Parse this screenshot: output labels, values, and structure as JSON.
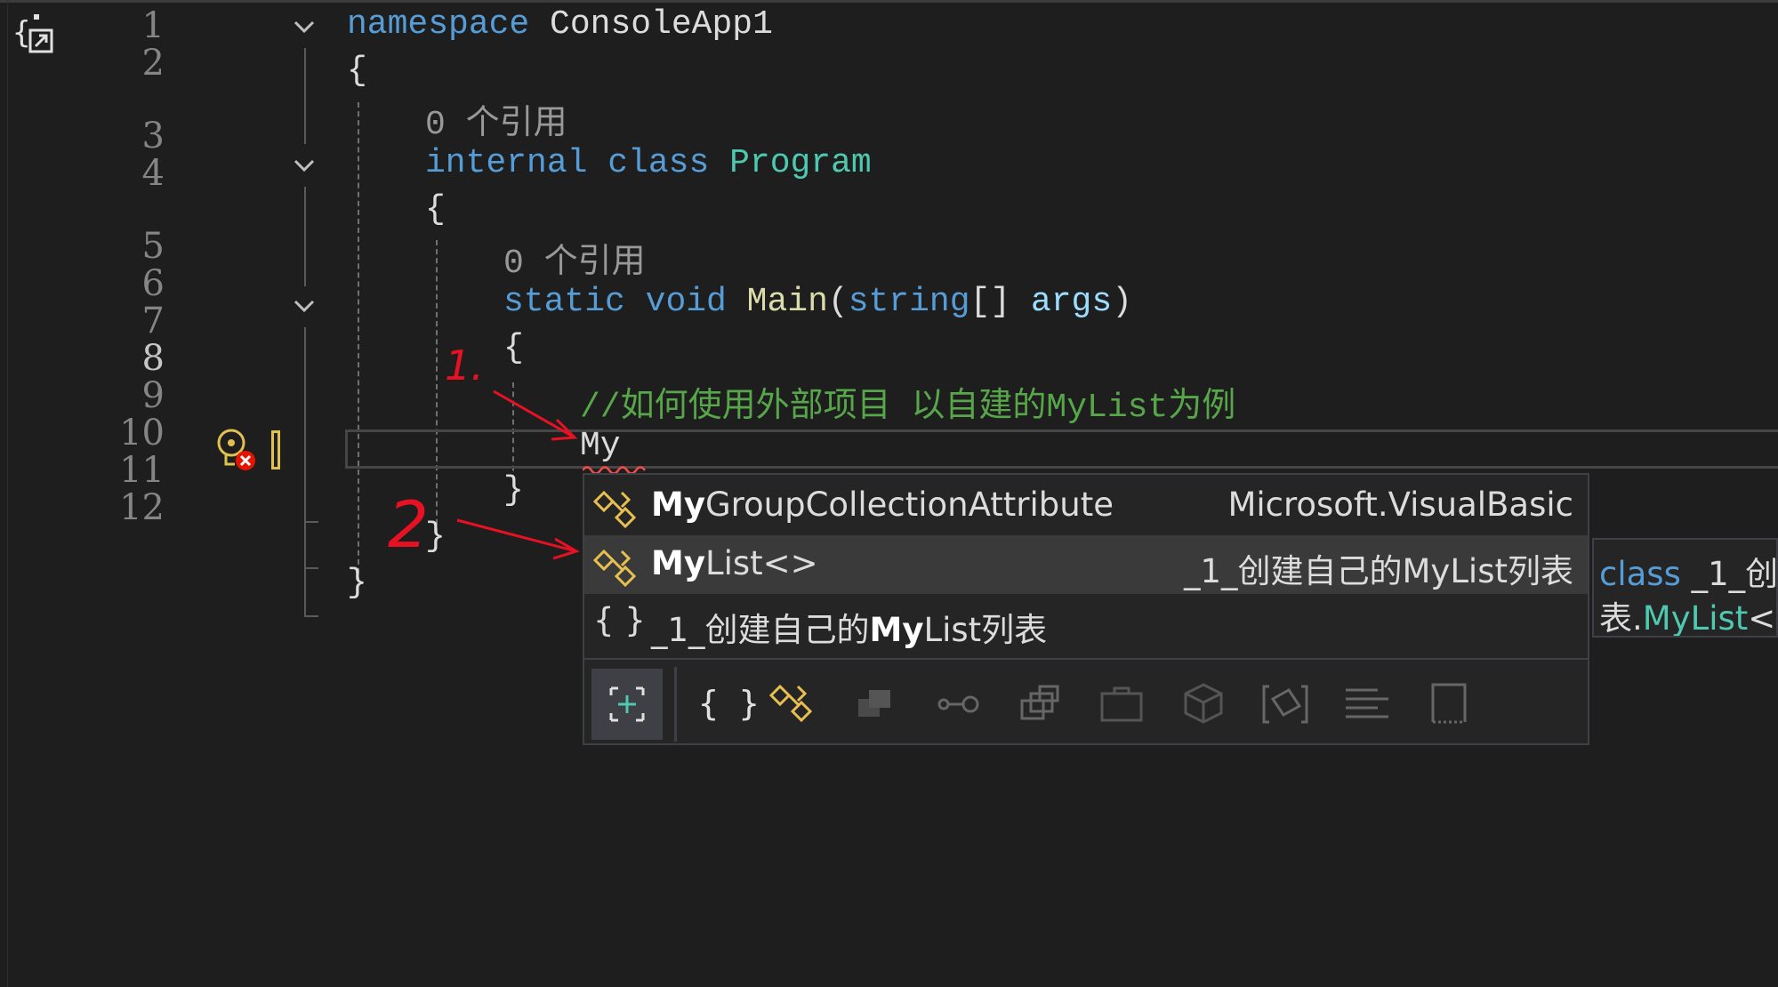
{
  "editor": {
    "line_numbers": [
      "1",
      "2",
      "3",
      "4",
      "5",
      "6",
      "7",
      "8",
      "9",
      "10",
      "11",
      "12"
    ],
    "line1": {
      "kw": "namespace",
      "id": "ConsoleApp1"
    },
    "line2": "{",
    "ref_label_class": "0 个引用",
    "line3": {
      "kw1": "internal",
      "kw2": "class",
      "ty": "Program"
    },
    "line4": "{",
    "ref_label_main": "0 个引用",
    "line5": {
      "kw1": "static",
      "kw2": "void",
      "me": "Main",
      "p1": "(",
      "kw3": "string",
      "p2": "[] ",
      "pr": "args",
      "p3": ")"
    },
    "line6": "{",
    "line7_comment": "//如何使用外部项目 以自建的MyList为例",
    "line8_typed": "My",
    "line9": "}",
    "line10": "}",
    "line11": "}"
  },
  "completion": {
    "items": [
      {
        "match": "My",
        "rest": "GroupCollectionAttribute",
        "namespace": "Microsoft.VisualBasic",
        "icon": "class-icon"
      },
      {
        "match": "My",
        "rest": "List<>",
        "namespace": "_1_创建自己的MyList列表",
        "icon": "class-icon",
        "selected": true
      },
      {
        "prefix": "_1_创建自己的",
        "match": "My",
        "rest": "List列表",
        "icon": "namespace-icon"
      }
    ],
    "namespace_brace": "{ }",
    "filter_icons": [
      "expand-icon",
      "namespace-filter-icon",
      "class-filter-icon",
      "struct-filter-icon",
      "interface-filter-icon",
      "method-filter-icon",
      "property-filter-icon",
      "module-filter-icon",
      "field-filter-icon",
      "event-filter-icon",
      "enum-filter-icon",
      "snippet-filter-icon"
    ]
  },
  "tooltip": {
    "kw": "class",
    "line1_rest": " _1_创",
    "line2_prefix": "表.",
    "line2_type": "MyList",
    "line2_rest": "<"
  },
  "annotations": [
    "1.",
    "2"
  ],
  "colors": {
    "background": "#1e1e1e",
    "keyword": "#569cd6",
    "type": "#4ec9b0",
    "comment": "#57a64a",
    "method": "#dcdcaa",
    "param": "#9cdcfe",
    "annotation": "#e81123"
  }
}
